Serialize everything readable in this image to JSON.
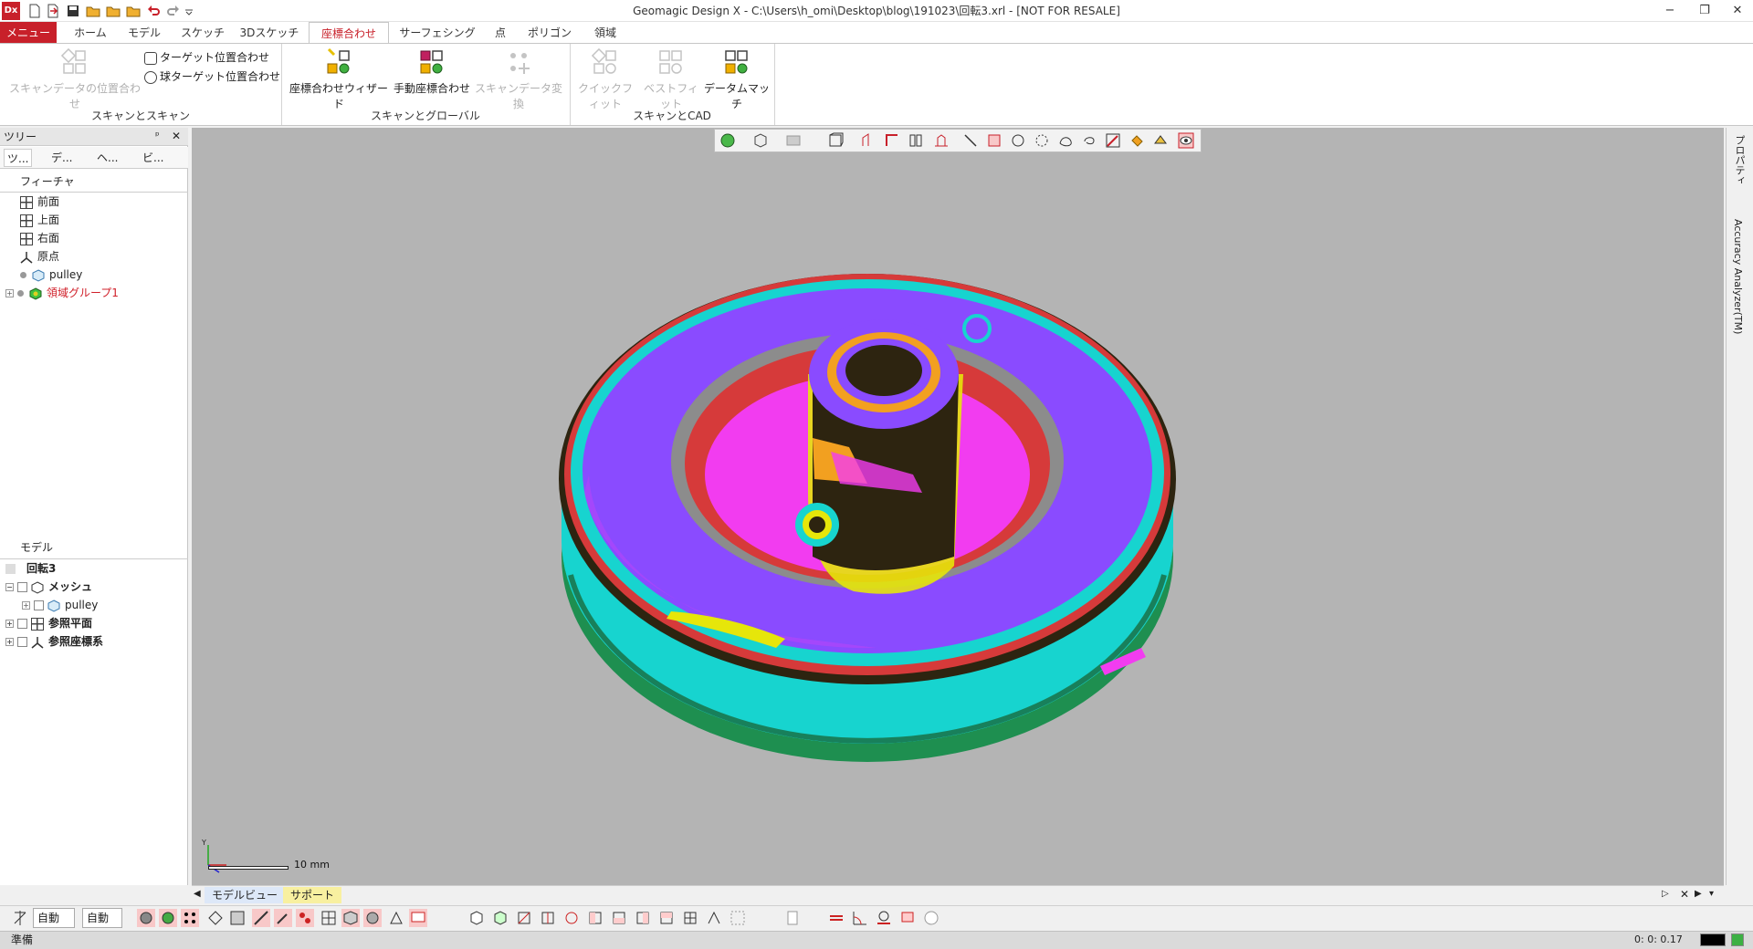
{
  "app": {
    "title": "Geomagic Design X - C:\\Users\\h_omi\\Desktop\\blog\\191023\\回転3.xrl - [NOT FOR RESALE]",
    "logo": "Dx"
  },
  "quick_access": [
    "new-file-icon",
    "import-icon",
    "save-icon",
    "open-folder-icon",
    "open-folder-icon",
    "open-folder-icon",
    "undo-icon",
    "redo-icon",
    "dropdown-arrow-icon"
  ],
  "window_controls": [
    "−",
    "❐",
    "✕"
  ],
  "tabs": [
    {
      "label": "メニュー",
      "kind": "menu"
    },
    {
      "label": "ホーム"
    },
    {
      "label": "モデル"
    },
    {
      "label": "スケッチ"
    },
    {
      "label": "3Dスケッチ"
    },
    {
      "label": "座標合わせ",
      "active": true
    },
    {
      "label": "サーフェシング"
    },
    {
      "label": "点"
    },
    {
      "label": "ポリゴン"
    },
    {
      "label": "領域"
    }
  ],
  "ribbon": {
    "groups": [
      {
        "title": "スキャンとスキャン"
      },
      {
        "title": "スキャンとグローバル"
      },
      {
        "title": "スキャンとCAD"
      }
    ],
    "scan_align": "スキャンデータの位置合わせ",
    "target_align": "ターゲット位置合わせ",
    "sphere_target_align": "球ターゲット位置合わせ",
    "align_wizard": "座標合わせウィザード",
    "manual_align": "手動座標合わせ",
    "scan_transform": "スキャンデータ変換",
    "quick_fit": "クイックフィット",
    "best_fit": "ベストフィット",
    "datum_match": "データムマッチ"
  },
  "left_panel": {
    "title": "ツリー",
    "pin": "ᵖ",
    "close": "✕",
    "tabs": [
      "ツ...",
      "デ...",
      "ヘ...",
      "ビ..."
    ],
    "feature_label": "フィーチャ",
    "features": [
      {
        "label": "前面",
        "icon": "plane-icon"
      },
      {
        "label": "上面",
        "icon": "plane-icon"
      },
      {
        "label": "右面",
        "icon": "plane-icon"
      },
      {
        "label": "原点",
        "icon": "origin-icon"
      },
      {
        "label": "pulley",
        "icon": "mesh-icon"
      },
      {
        "label": "領域グループ1",
        "icon": "region-group-icon",
        "red": true
      }
    ],
    "model_label": "モデル",
    "model_items": [
      {
        "label": "回転3",
        "icon": "document-icon"
      },
      {
        "label": "メッシュ",
        "icon": "mesh-folder-icon"
      },
      {
        "label": "pulley",
        "icon": "mesh-icon"
      },
      {
        "label": "参照平面",
        "icon": "plane-icon"
      },
      {
        "label": "参照座標系",
        "icon": "origin-icon"
      }
    ]
  },
  "viewport": {
    "scale_label": "10 mm",
    "background": "#b4b4b4"
  },
  "right_panel": {
    "tab1": "プロパティ",
    "tab2": "Accuracy Analyzer(TM)"
  },
  "bottom_tabs": [
    "モデルビュー",
    "サポート"
  ],
  "bottom_toolbar": {
    "select1": "自動",
    "select2": "自動"
  },
  "status": {
    "text": "準備",
    "coords": "0: 0: 0.17"
  },
  "colors": {
    "accent": "#c8202a",
    "purple": "#8a4bff",
    "cyan": "#17d4cf",
    "magenta": "#f23cf0",
    "red": "#d63a3a",
    "gray": "#8c8c8c",
    "dark": "#2d2410",
    "yellow": "#e6e60a"
  }
}
